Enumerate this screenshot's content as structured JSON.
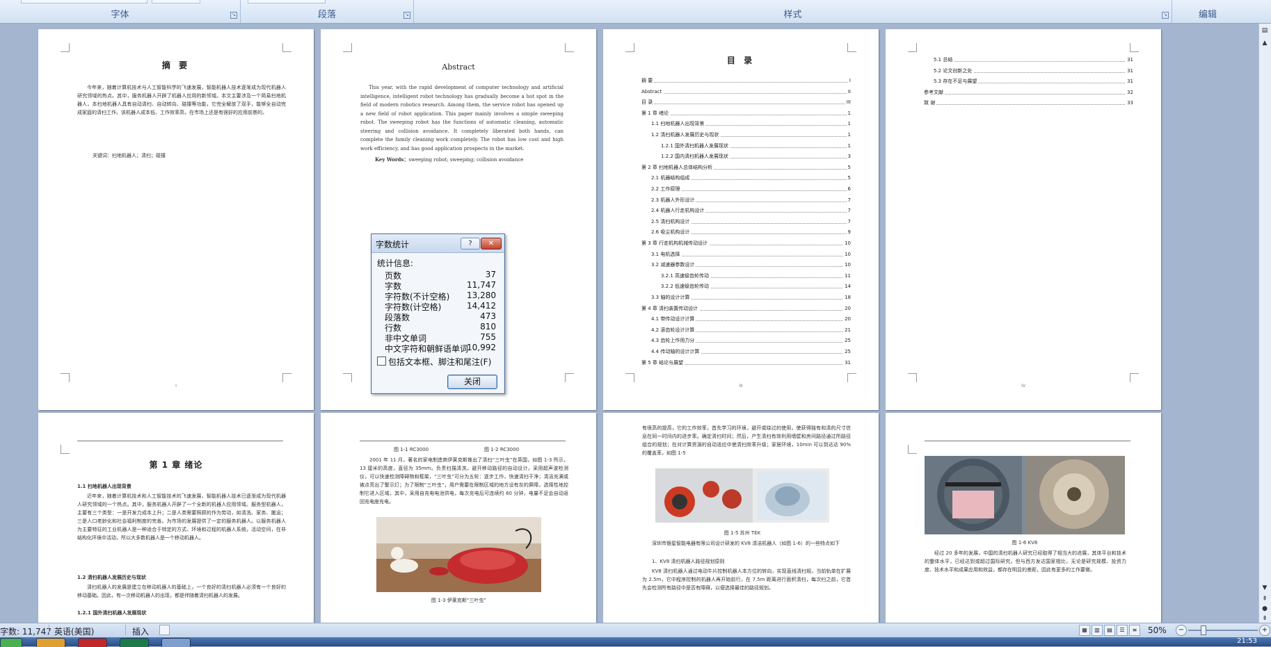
{
  "ribbon": {
    "groups": [
      {
        "label": "字体"
      },
      {
        "label": "段落"
      },
      {
        "label": "样式"
      },
      {
        "label": "编辑"
      }
    ]
  },
  "pages": {
    "abstract_cn": {
      "title": "摘  要",
      "body": "今年来，随着计算机技术与人工智能科学的飞速发展，智能机器人技术逐渐成为现代机器人研究领域的热点。其中，服务机器人开辟了机器人应用的新领域。本文主要涉及一个简易扫地机器人，本扫地机器人具有自动清扫、自动转向、碰撞等功能，它完全解放了双手，能够全自动完成家庭的清扫工作。该机器人成本低、工作效率高，在市场上还是有很好的应用前景的。",
      "keywords": "关键词：扫地机器人；清扫；碰撞",
      "page_num": "I"
    },
    "abstract_en": {
      "title": "Abstract",
      "body": "This year, with the rapid development of computer technology and artificial intelligence, intelligent robot technology has gradually become a hot spot in the field of modern robotics research. Among them, the service robot has opened up a new field of robot application. This paper mainly involves a simple sweeping robot. The sweeping robot has the functions of automatic cleaning, automatic steering and collision avoidance. It completely liberated both hands, can complete the family cleaning work completely. The robot has low cost and high work efficiency, and has good application prospects in the market.",
      "keywords_label": "Key Words：",
      "keywords": "sweeping robot; sweeping; collision avoidance"
    },
    "toc": {
      "title": "目  录",
      "entries": [
        {
          "t": "摘  要",
          "n": "I",
          "lvl": 0
        },
        {
          "t": "Abstract",
          "n": "II",
          "lvl": 0
        },
        {
          "t": "目  录",
          "n": "III",
          "lvl": 0
        },
        {
          "t": "第 1 章  绪论",
          "n": "1",
          "lvl": 0
        },
        {
          "t": "1.1  扫地机器人出现背景",
          "n": "1",
          "lvl": 1
        },
        {
          "t": "1.2  清扫机器人发展历史与现状",
          "n": "1",
          "lvl": 1
        },
        {
          "t": "1.2.1  国外清扫机器人发展现状",
          "n": "1",
          "lvl": 2
        },
        {
          "t": "1.2.2  国内清扫机器人发展现状",
          "n": "3",
          "lvl": 2
        },
        {
          "t": "第 2 章  扫地机器人总体结构分析",
          "n": "5",
          "lvl": 0
        },
        {
          "t": "2.1 机器结构组成",
          "n": "5",
          "lvl": 1
        },
        {
          "t": "2.2 工作原理",
          "n": "6",
          "lvl": 1
        },
        {
          "t": "2.3 机器人外形设计",
          "n": "7",
          "lvl": 1
        },
        {
          "t": "2.4 机器人行走机构设计",
          "n": "7",
          "lvl": 1
        },
        {
          "t": "2.5 清扫机构设计",
          "n": "7",
          "lvl": 1
        },
        {
          "t": "2.6 吸尘机构设计",
          "n": "9",
          "lvl": 1
        },
        {
          "t": "第 3 章  行走机构机械传动设计",
          "n": "10",
          "lvl": 0
        },
        {
          "t": "3.1  电机选择",
          "n": "10",
          "lvl": 1
        },
        {
          "t": "3.2  减速器参数设计",
          "n": "10",
          "lvl": 1
        },
        {
          "t": "3.2.1  高速级齿轮传动",
          "n": "11",
          "lvl": 2
        },
        {
          "t": "3.2.2  低速级齿轮传动",
          "n": "14",
          "lvl": 2
        },
        {
          "t": "3.3 轴的设计计算",
          "n": "18",
          "lvl": 1
        },
        {
          "t": "第 4 章  清扫装置传动设计",
          "n": "20",
          "lvl": 0
        },
        {
          "t": "4.1  带传动设计计算",
          "n": "20",
          "lvl": 1
        },
        {
          "t": "4.2   滚齿轮设计计算",
          "n": "21",
          "lvl": 1
        },
        {
          "t": "4.3  齿轮上作用力分",
          "n": "25",
          "lvl": 1
        },
        {
          "t": "4.4 传动轴的设计计算",
          "n": "25",
          "lvl": 1
        },
        {
          "t": "第 5 章  结论与展望",
          "n": "31",
          "lvl": 0
        }
      ],
      "page_num": "III"
    },
    "toc2": {
      "entries": [
        {
          "t": "5.1  总结",
          "n": "31",
          "lvl": 1
        },
        {
          "t": "5.2  论文创新之处",
          "n": "31",
          "lvl": 1
        },
        {
          "t": "5.3  存在不足与展望",
          "n": "31",
          "lvl": 1
        },
        {
          "t": "参考文献",
          "n": "32",
          "lvl": 0
        },
        {
          "t": "致  谢",
          "n": "33",
          "lvl": 0
        }
      ],
      "page_num": "IV"
    },
    "ch1": {
      "title": "第 1 章  绪论",
      "h1": "1.1 扫地机器人出现背景",
      "p1": "近年来，随着计算机技术和人工智能技术的飞速发展，智能机器人技术已逐渐成为现代机器人研究领域的一个热点。其中，服务机器人开辟了一个全新的机器人应用领域。服务型机器人，主要有三个类型：一是开发力成本上升；二是人类需要照顾的作为劳动，如清洗、家务、搬运；三是人口老龄化和社会福利制度的完善。为市场的发展提供了一定的服务机器人。以服务机器人为主要特征的工业机器人是一种适合于特定的方式、环境和过程的机器人系统，活动空间，在非结构化环境中活动，所以大多数机器人是一个移动机器人。",
      "h2": "1.2 清扫机器人发展历史与现状",
      "p2": "清扫机器人的发展是建立在移动机器人的基础上，一个良好的清扫机器人必须有一个良好的移动基础。因此，有一次移动机器人的出现，都是伴随着清扫机器人的发展。",
      "h3": "1.2.1 国外清扫机器人发展现状"
    },
    "p6": {
      "cap_top_l": "图 1-1 RC3000",
      "cap_top_r": "图 1-2 RC3000",
      "body": "2001 年 11 月，著名的家电制造商伊莱克斯推出了清扫“三叶虫”在英国，如图 1-3 所示，13 厘米的高度，直径为 35mm。负责扫描清洗，避开移动路径的自动设计，采用超声波检测仪，可以快速检测障碍物和框架，“三叶虫”可分为五轮：逐步工作，快速清扫干净；清洁充满或被点亮出了警示灯；为了限制“三叶虫”，用户需要在限制区域的地方设有灰的屏障，选择性地控制它进入区域，其中，采用自充电电池供电，每次充电后可连续约 60 分钟，电量不足会自动返回充电座充电。",
      "cap_fig": "图 1-3  伊莱克斯“三叶虫”"
    },
    "p7": {
      "body": "有很高的提高，它的工作效率，首先学习的环境，避开或绕过的使用，使获得独有和清的尺寸信息在同一时间内的进步率。确定清扫时间；然后，产生清扫有效利用墙壁和房间路径通过所路径组合的规划；在对计算资源的自动适应中使清扫效率升级；家居环境，10min 可以到达达 90% 的覆盖率，如图 1-5",
      "cap_fig": "图 1-5  苏州  TEK",
      "body2": "深圳市银星智能电器有限公司设计研发的 KV8 清洁机器人（如图 1-6）的一些特点如下",
      "list1": "1、KV8 清扫机器人路径规划原则",
      "body3": "KV8 清扫机器人通过电动牛片控制机器人本方位的转向，实现直线清扫规，当前轨单在扩展为 2.5m，它中程序控制的机器人再开始前行，在 7.5m 距离进行面积清扫，每次扫之前，它首先会检测所有路径中是否有障碍，以便选择最佳的路径规划。"
    },
    "p8": {
      "cap_fig": "图 1-6 KV8",
      "body": "经过 20 多年的发展，中国的清扫机器人研究已经取得了相当大的进展，其体平台和技术的整体水平，已经达到或超过国际研究，但与西方发达国家相比，无论是研究规模、投资力度、技术水平和成果应用和效益，都存在明显的差距，因此有更多的工作要做。"
    }
  },
  "dialog": {
    "title": "字数统计",
    "help": "?",
    "close_glyph": "✕",
    "section": "统计信息:",
    "rows": [
      {
        "label": "页数",
        "value": "37"
      },
      {
        "label": "字数",
        "value": "11,747"
      },
      {
        "label": "字符数(不计空格)",
        "value": "13,280"
      },
      {
        "label": "字符数(计空格)",
        "value": "14,412"
      },
      {
        "label": "段落数",
        "value": "473"
      },
      {
        "label": "行数",
        "value": "810"
      },
      {
        "label": "非中文单词",
        "value": "755"
      },
      {
        "label": "中文字符和朝鲜语单词",
        "value": "10,992"
      }
    ],
    "checkbox_label": "包括文本框、脚注和尾注(F)",
    "button": "关闭"
  },
  "status": {
    "word_count": "字数: 11,747",
    "language": "英语(美国)",
    "insert": "插入",
    "zoom": "50%"
  },
  "taskbar": {
    "clock": "21:53"
  }
}
